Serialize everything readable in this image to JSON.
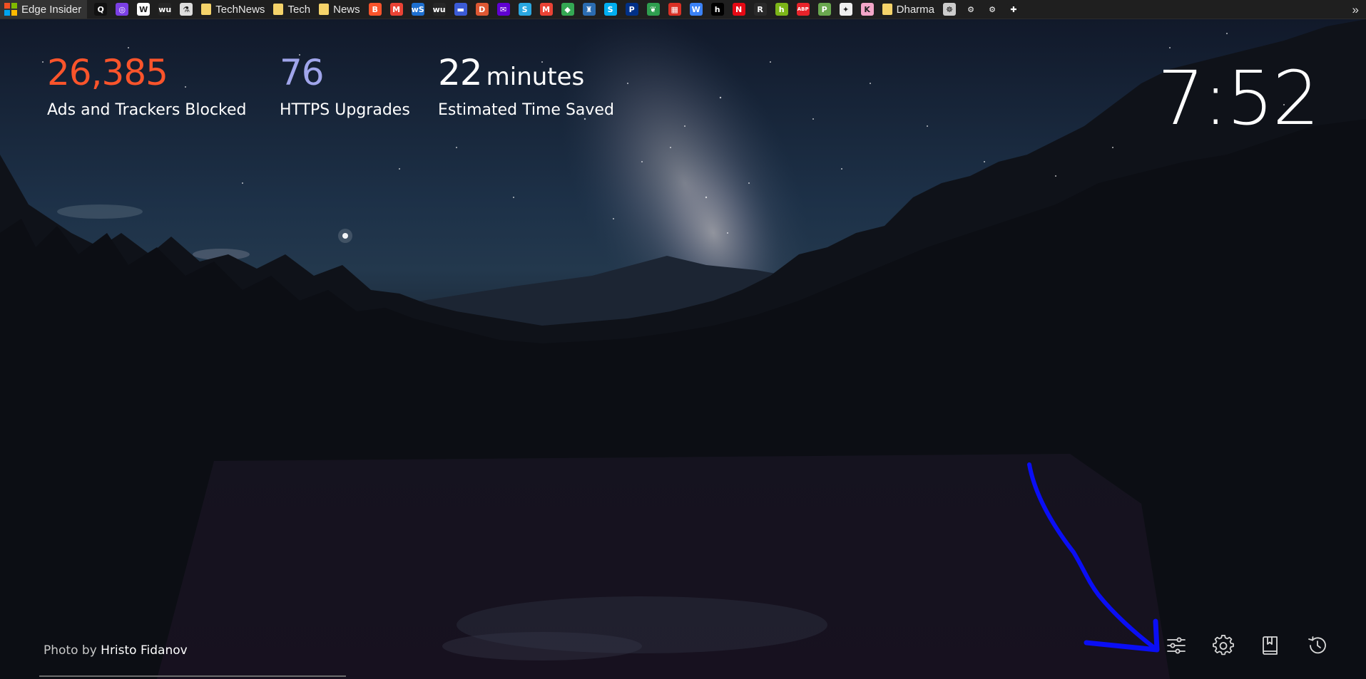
{
  "bookmarks_bar": {
    "items": [
      {
        "type": "site",
        "label": "Edge Insider",
        "icon": "windows-logo-icon"
      },
      {
        "type": "site",
        "label": "",
        "icon": "q-icon",
        "color": "#111111",
        "glyph": "Q"
      },
      {
        "type": "site",
        "label": "",
        "icon": "ring-icon",
        "color": "#7b3fe4",
        "glyph": "◎"
      },
      {
        "type": "site",
        "label": "",
        "icon": "wikipedia-icon",
        "color": "#ffffff",
        "glyph": "W"
      },
      {
        "type": "site",
        "label": "",
        "icon": "wu-icon",
        "color": "#262626",
        "glyph": "wu"
      },
      {
        "type": "site",
        "label": "",
        "icon": "flask-icon",
        "color": "#dddddd",
        "glyph": "⚗"
      },
      {
        "type": "folder",
        "label": "TechNews",
        "icon": "folder-icon"
      },
      {
        "type": "folder",
        "label": "Tech",
        "icon": "folder-icon"
      },
      {
        "type": "folder",
        "label": "News",
        "icon": "folder-icon"
      },
      {
        "type": "site",
        "label": "",
        "icon": "brave-icon",
        "color": "#fb542b",
        "glyph": "B"
      },
      {
        "type": "site",
        "label": "",
        "icon": "gmail-icon",
        "color": "#ea4335",
        "glyph": "M"
      },
      {
        "type": "site",
        "label": "",
        "icon": "ws-icon",
        "color": "#1d6fcf",
        "glyph": "wS"
      },
      {
        "type": "site",
        "label": "",
        "icon": "wu-icon",
        "color": "#262626",
        "glyph": "wu"
      },
      {
        "type": "site",
        "label": "",
        "icon": "window-icon",
        "color": "#3b5bd6",
        "glyph": "▬"
      },
      {
        "type": "site",
        "label": "",
        "icon": "duckduckgo-icon",
        "color": "#de5833",
        "glyph": "D"
      },
      {
        "type": "site",
        "label": "",
        "icon": "mail-icon",
        "color": "#6001d2",
        "glyph": "✉"
      },
      {
        "type": "site",
        "label": "",
        "icon": "s-icon",
        "color": "#2aa7e0",
        "glyph": "S"
      },
      {
        "type": "site",
        "label": "",
        "icon": "gmail-icon",
        "color": "#ea4335",
        "glyph": "M"
      },
      {
        "type": "site",
        "label": "",
        "icon": "maps-icon",
        "color": "#34a853",
        "glyph": "◆"
      },
      {
        "type": "site",
        "label": "",
        "icon": "castle-icon",
        "color": "#2b6cb0",
        "glyph": "♜"
      },
      {
        "type": "site",
        "label": "",
        "icon": "skype-icon",
        "color": "#00aff0",
        "glyph": "S"
      },
      {
        "type": "site",
        "label": "",
        "icon": "paypal-icon",
        "color": "#003087",
        "glyph": "P"
      },
      {
        "type": "site",
        "label": "",
        "icon": "leaf-icon",
        "color": "#2e9e4f",
        "glyph": "❦"
      },
      {
        "type": "site",
        "label": "",
        "icon": "calendar-icon",
        "color": "#d93025",
        "glyph": "▦"
      },
      {
        "type": "site",
        "label": "",
        "icon": "w-circle-icon",
        "color": "#3b82f6",
        "glyph": "W"
      },
      {
        "type": "site",
        "label": "",
        "icon": "h-icon",
        "color": "#000000",
        "glyph": "h"
      },
      {
        "type": "site",
        "label": "",
        "icon": "netflix-icon",
        "color": "#e50914",
        "glyph": "N"
      },
      {
        "type": "site",
        "label": "",
        "icon": "r-icon",
        "color": "#2a2a2a",
        "glyph": "R"
      },
      {
        "type": "site",
        "label": "",
        "icon": "h-green-icon",
        "color": "#7cb518",
        "glyph": "h"
      },
      {
        "type": "site",
        "label": "",
        "icon": "adblock-icon",
        "color": "#e8232a",
        "glyph": "ABP"
      },
      {
        "type": "site",
        "label": "",
        "icon": "p-green-icon",
        "color": "#6aa84f",
        "glyph": "P"
      },
      {
        "type": "site",
        "label": "",
        "icon": "badger-icon",
        "color": "#eeeeee",
        "glyph": "✦"
      },
      {
        "type": "site",
        "label": "",
        "icon": "k-icon",
        "color": "#f4a6c8",
        "glyph": "K"
      },
      {
        "type": "folder",
        "label": "Dharma",
        "icon": "folder-icon"
      },
      {
        "type": "site",
        "label": "",
        "icon": "wheel-icon",
        "color": "#cccccc",
        "glyph": "☸"
      },
      {
        "type": "site",
        "label": "",
        "icon": "gear-icon",
        "color": "#1f1f1f",
        "glyph": "⚙"
      },
      {
        "type": "site",
        "label": "",
        "icon": "gear-icon",
        "color": "#1f1f1f",
        "glyph": "⚙"
      },
      {
        "type": "site",
        "label": "",
        "icon": "puzzle-icon",
        "color": "#1f1f1f",
        "glyph": "✚"
      }
    ],
    "overflow_glyph": "»"
  },
  "stats": {
    "ads_blocked": {
      "value": "26,385",
      "label": "Ads and Trackers Blocked",
      "color": "#fb542b"
    },
    "https_upgrades": {
      "value": "76",
      "label": "HTTPS Upgrades",
      "color": "#a0a5eb"
    },
    "time_saved": {
      "value": "22",
      "unit": "minutes",
      "label": "Estimated Time Saved",
      "color": "#ffffff"
    }
  },
  "clock": {
    "time": "7:52"
  },
  "credit": {
    "prefix": "Photo by",
    "author": "Hristo Fidanov"
  },
  "footer_icons": [
    "customize-sliders-icon",
    "settings-gear-icon",
    "bookmarks-icon",
    "history-icon"
  ],
  "annotation": {
    "color": "#0a0ef5"
  }
}
